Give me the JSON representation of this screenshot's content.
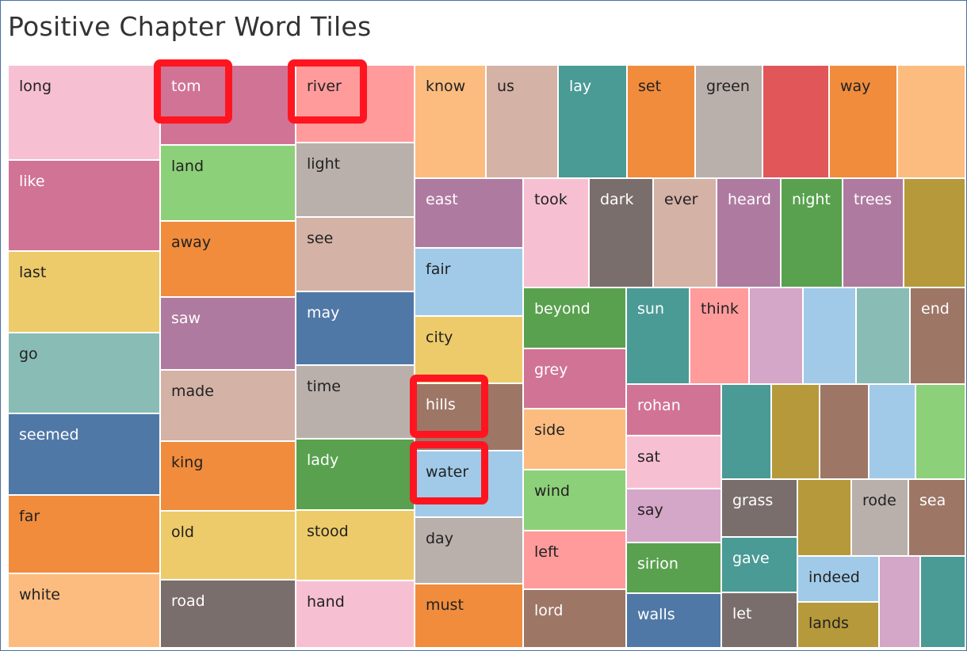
{
  "title": "Positive Chapter Word Tiles",
  "chart_data": {
    "type": "treemap",
    "title": "Positive Chapter Word Tiles",
    "tiles": [
      {
        "word": "long",
        "color": "#f7c0d2",
        "text": "#222222"
      },
      {
        "word": "like",
        "color": "#d17395",
        "text": "#ffffff"
      },
      {
        "word": "last",
        "color": "#edcb6a",
        "text": "#222222"
      },
      {
        "word": "go",
        "color": "#89bcb5",
        "text": "#222222"
      },
      {
        "word": "seemed",
        "color": "#5078a6",
        "text": "#ffffff"
      },
      {
        "word": "far",
        "color": "#f08c3c",
        "text": "#222222"
      },
      {
        "word": "white",
        "color": "#fcbc80",
        "text": "#222222"
      },
      {
        "word": "tom",
        "color": "#d17395",
        "text": "#ffffff",
        "highlighted": true
      },
      {
        "word": "land",
        "color": "#8dd07a",
        "text": "#222222"
      },
      {
        "word": "away",
        "color": "#f08c3c",
        "text": "#222222"
      },
      {
        "word": "saw",
        "color": "#af7aa0",
        "text": "#ffffff"
      },
      {
        "word": "made",
        "color": "#d4b2a6",
        "text": "#222222"
      },
      {
        "word": "king",
        "color": "#f08c3c",
        "text": "#222222"
      },
      {
        "word": "old",
        "color": "#edcb6a",
        "text": "#222222"
      },
      {
        "word": "road",
        "color": "#7a6e6c",
        "text": "#ffffff"
      },
      {
        "word": "river",
        "color": "#ff9b9b",
        "text": "#222222",
        "highlighted": true
      },
      {
        "word": "light",
        "color": "#bab0ab",
        "text": "#222222"
      },
      {
        "word": "see",
        "color": "#d4b2a6",
        "text": "#222222"
      },
      {
        "word": "may",
        "color": "#5078a6",
        "text": "#ffffff"
      },
      {
        "word": "time",
        "color": "#bab0ab",
        "text": "#222222"
      },
      {
        "word": "lady",
        "color": "#59a14f",
        "text": "#ffffff"
      },
      {
        "word": "stood",
        "color": "#edcb6a",
        "text": "#222222"
      },
      {
        "word": "hand",
        "color": "#f7c0d2",
        "text": "#222222"
      },
      {
        "word": "know",
        "color": "#fcbc80",
        "text": "#222222"
      },
      {
        "word": "us",
        "color": "#d4b2a6",
        "text": "#222222"
      },
      {
        "word": "lay",
        "color": "#4a9a95",
        "text": "#ffffff"
      },
      {
        "word": "set",
        "color": "#f08c3c",
        "text": "#222222"
      },
      {
        "word": "green",
        "color": "#bab0ab",
        "text": "#222222"
      },
      {
        "word": "",
        "color": "#e15659",
        "text": "#ffffff"
      },
      {
        "word": "way",
        "color": "#f08c3c",
        "text": "#222222"
      },
      {
        "word": "",
        "color": "#fcbc80",
        "text": "#222222"
      },
      {
        "word": "east",
        "color": "#af7aa0",
        "text": "#ffffff"
      },
      {
        "word": "took",
        "color": "#f7c0d2",
        "text": "#222222"
      },
      {
        "word": "dark",
        "color": "#7a6e6c",
        "text": "#ffffff"
      },
      {
        "word": "ever",
        "color": "#d4b2a6",
        "text": "#222222"
      },
      {
        "word": "heard",
        "color": "#af7aa0",
        "text": "#ffffff"
      },
      {
        "word": "night",
        "color": "#59a14f",
        "text": "#ffffff"
      },
      {
        "word": "trees",
        "color": "#af7aa0",
        "text": "#ffffff"
      },
      {
        "word": "",
        "color": "#b6993a",
        "text": "#ffffff"
      },
      {
        "word": "fair",
        "color": "#a1cae8",
        "text": "#222222"
      },
      {
        "word": "city",
        "color": "#edcb6a",
        "text": "#222222"
      },
      {
        "word": "hills",
        "color": "#9d7666",
        "text": "#ffffff",
        "highlighted": true
      },
      {
        "word": "water",
        "color": "#a1cae8",
        "text": "#222222",
        "highlighted": true
      },
      {
        "word": "day",
        "color": "#bab0ab",
        "text": "#222222"
      },
      {
        "word": "must",
        "color": "#f08c3c",
        "text": "#222222"
      },
      {
        "word": "beyond",
        "color": "#59a14f",
        "text": "#ffffff"
      },
      {
        "word": "grey",
        "color": "#d17395",
        "text": "#ffffff"
      },
      {
        "word": "side",
        "color": "#fcbc80",
        "text": "#222222"
      },
      {
        "word": "wind",
        "color": "#8dd07a",
        "text": "#222222"
      },
      {
        "word": "left",
        "color": "#ff9b9b",
        "text": "#222222"
      },
      {
        "word": "lord",
        "color": "#9d7666",
        "text": "#ffffff"
      },
      {
        "word": "sun",
        "color": "#4a9a95",
        "text": "#ffffff"
      },
      {
        "word": "think",
        "color": "#ff9b9b",
        "text": "#222222"
      },
      {
        "word": "",
        "color": "#d4a6c8",
        "text": "#222222"
      },
      {
        "word": "",
        "color": "#a1cae8",
        "text": "#222222"
      },
      {
        "word": "",
        "color": "#89bcb5",
        "text": "#222222"
      },
      {
        "word": "end",
        "color": "#9d7666",
        "text": "#ffffff"
      },
      {
        "word": "rohan",
        "color": "#d17395",
        "text": "#ffffff"
      },
      {
        "word": "sat",
        "color": "#f7c0d2",
        "text": "#222222"
      },
      {
        "word": "say",
        "color": "#d4a6c8",
        "text": "#222222"
      },
      {
        "word": "sirion",
        "color": "#59a14f",
        "text": "#ffffff"
      },
      {
        "word": "walls",
        "color": "#5078a6",
        "text": "#ffffff"
      },
      {
        "word": "",
        "color": "#4a9a95",
        "text": "#ffffff"
      },
      {
        "word": "",
        "color": "#b6993a",
        "text": "#ffffff"
      },
      {
        "word": "",
        "color": "#9d7666",
        "text": "#ffffff"
      },
      {
        "word": "",
        "color": "#a1cae8",
        "text": "#222222"
      },
      {
        "word": "",
        "color": "#8dd07a",
        "text": "#222222"
      },
      {
        "word": "grass",
        "color": "#7a6e6c",
        "text": "#ffffff"
      },
      {
        "word": "gave",
        "color": "#4a9a95",
        "text": "#ffffff"
      },
      {
        "word": "let",
        "color": "#7a6e6c",
        "text": "#ffffff"
      },
      {
        "word": "",
        "color": "#b6993a",
        "text": "#ffffff"
      },
      {
        "word": "rode",
        "color": "#bab0ab",
        "text": "#222222"
      },
      {
        "word": "sea",
        "color": "#9d7666",
        "text": "#ffffff"
      },
      {
        "word": "indeed",
        "color": "#a1cae8",
        "text": "#222222"
      },
      {
        "word": "lands",
        "color": "#b6993a",
        "text": "#222222"
      },
      {
        "word": "",
        "color": "#d4a6c8",
        "text": "#222222"
      },
      {
        "word": "",
        "color": "#4a9a95",
        "text": "#ffffff"
      }
    ]
  }
}
